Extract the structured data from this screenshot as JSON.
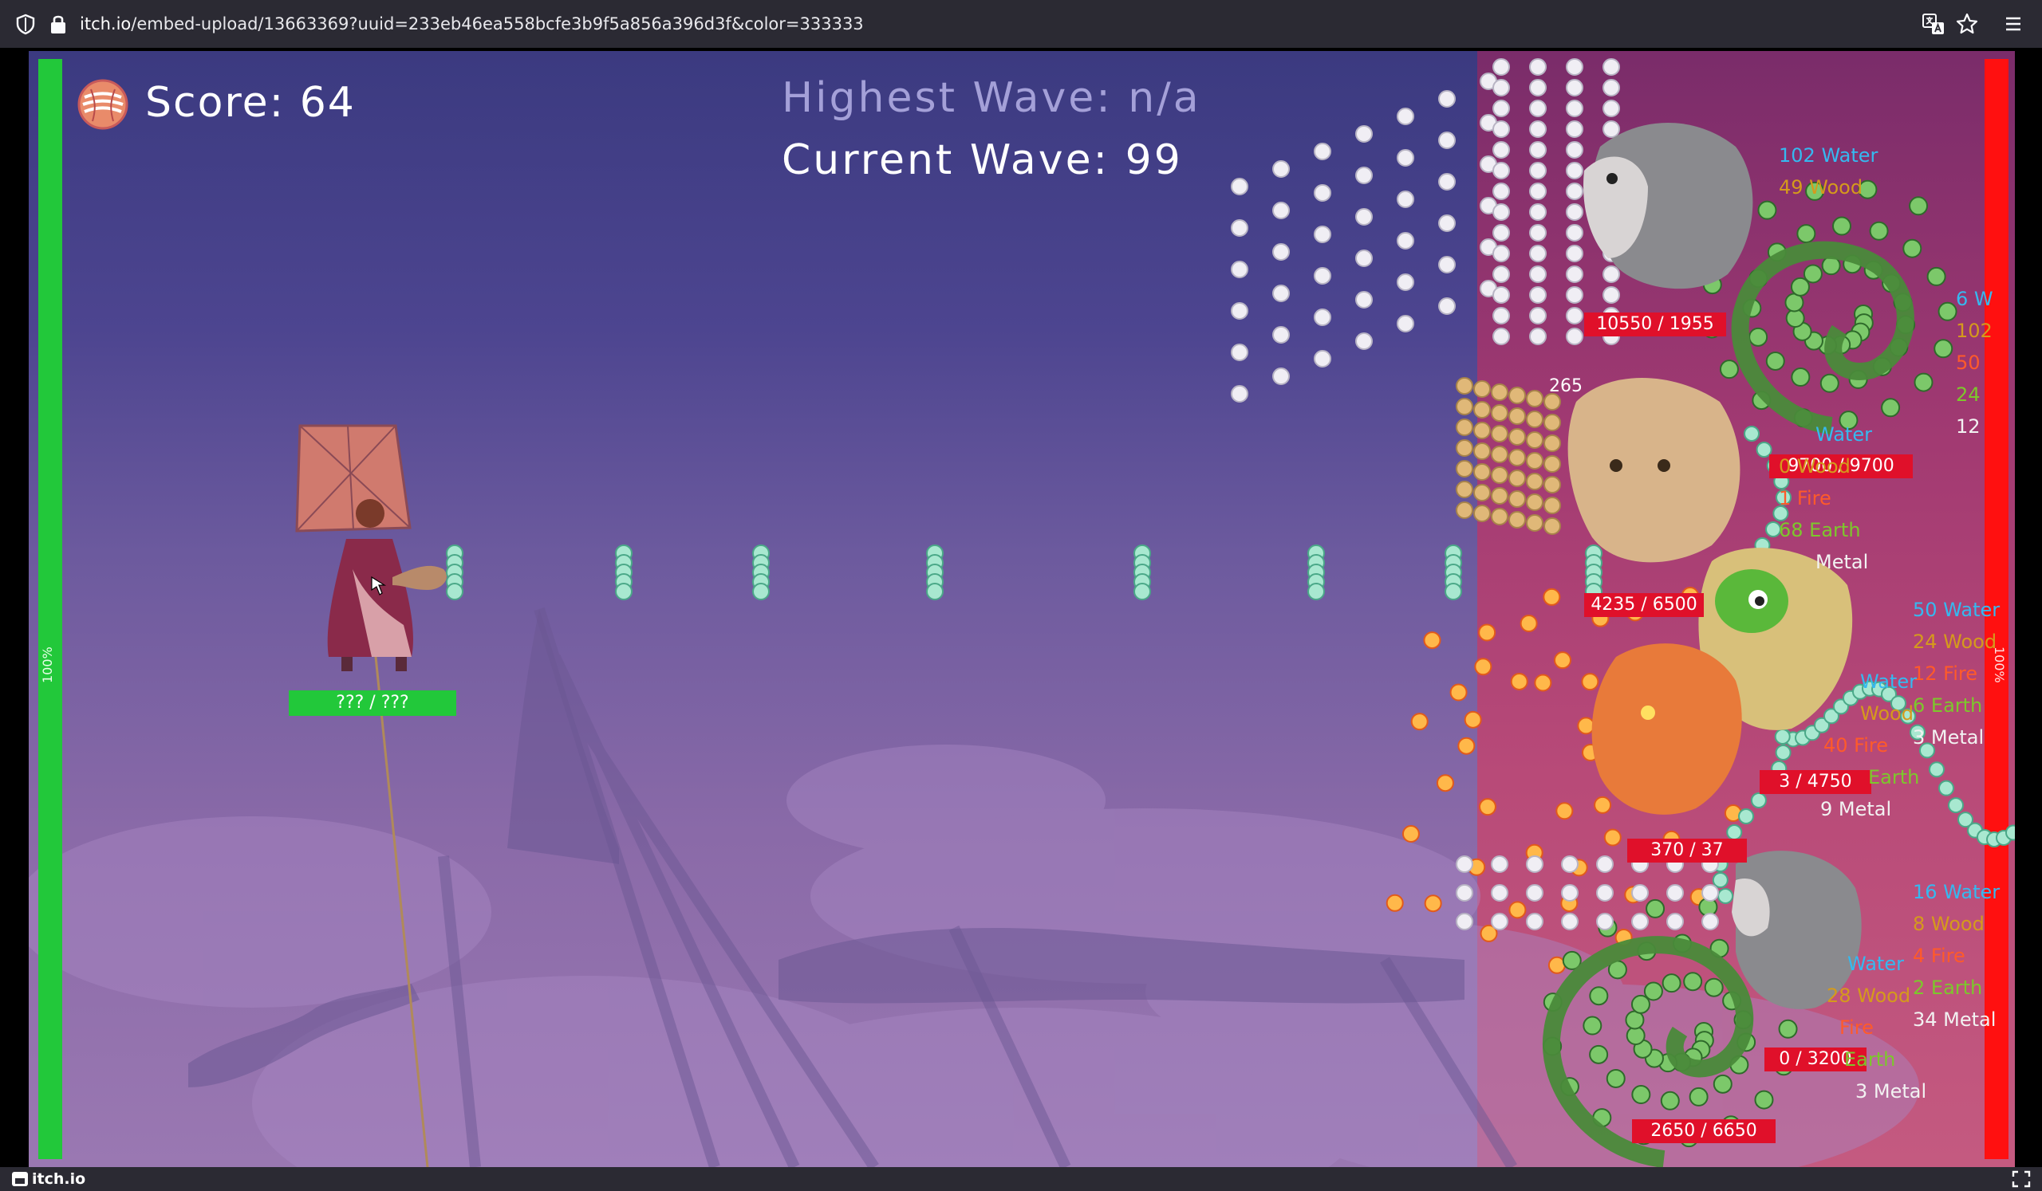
{
  "browser": {
    "url_host": "itch.io",
    "url_path": "/embed-upload/13663369?uuid=233eb46ea558bcfe3b9f5a856a396d3f&color=333333",
    "icons": [
      "shield-icon",
      "lock-icon",
      "translate-icon",
      "star-icon",
      "menu-icon"
    ]
  },
  "hud": {
    "score": "Score: 64",
    "highest_wave": "Highest Wave: n/a",
    "current_wave": "Current Wave:  99",
    "left_hp_label": "100%",
    "right_hp_label": "100%",
    "player_hp": "??? / ???"
  },
  "enemies": {
    "hedgehog_top_hp": "10550 / 1955",
    "tiger_dmg": "265",
    "tiger_hp": "9700 / 9700",
    "cat_hp": "4235 / 6500",
    "fire_hp": "3 / 4750",
    "fire_hp2": "370 / 37",
    "tree_hp": "0 / 3200",
    "tree_bottom_hp": "2650 / 6650"
  },
  "stats": {
    "group1": [
      "102 Water",
      "49 Wood"
    ],
    "group2": [
      "6 W",
      "102",
      "50",
      "24",
      "12"
    ],
    "group3": [
      "Water",
      "0 Wood",
      "1 Fire",
      "68 Earth",
      "Metal"
    ],
    "group4": [
      "50 Water",
      "24 Wood",
      "12 Fire",
      "6 Earth",
      "3 Metal"
    ],
    "group5": [
      "Water",
      "Wood",
      "40 Fire",
      "Earth",
      "9 Metal"
    ],
    "group6": [
      "16 Water",
      "8 Wood",
      "4 Fire",
      "2 Earth",
      "34 Metal"
    ],
    "group7": [
      "Water",
      "28 Wood",
      "Fire",
      "Earth",
      "3 Metal"
    ]
  },
  "footer": {
    "brand": "itch.io",
    "icons": [
      "itchio-logo-icon",
      "fullscreen-icon"
    ]
  },
  "colors": {
    "player_hp": "#22c83a",
    "enemy_hp": "#ff1010",
    "enemy_bar": "#e0102a"
  }
}
